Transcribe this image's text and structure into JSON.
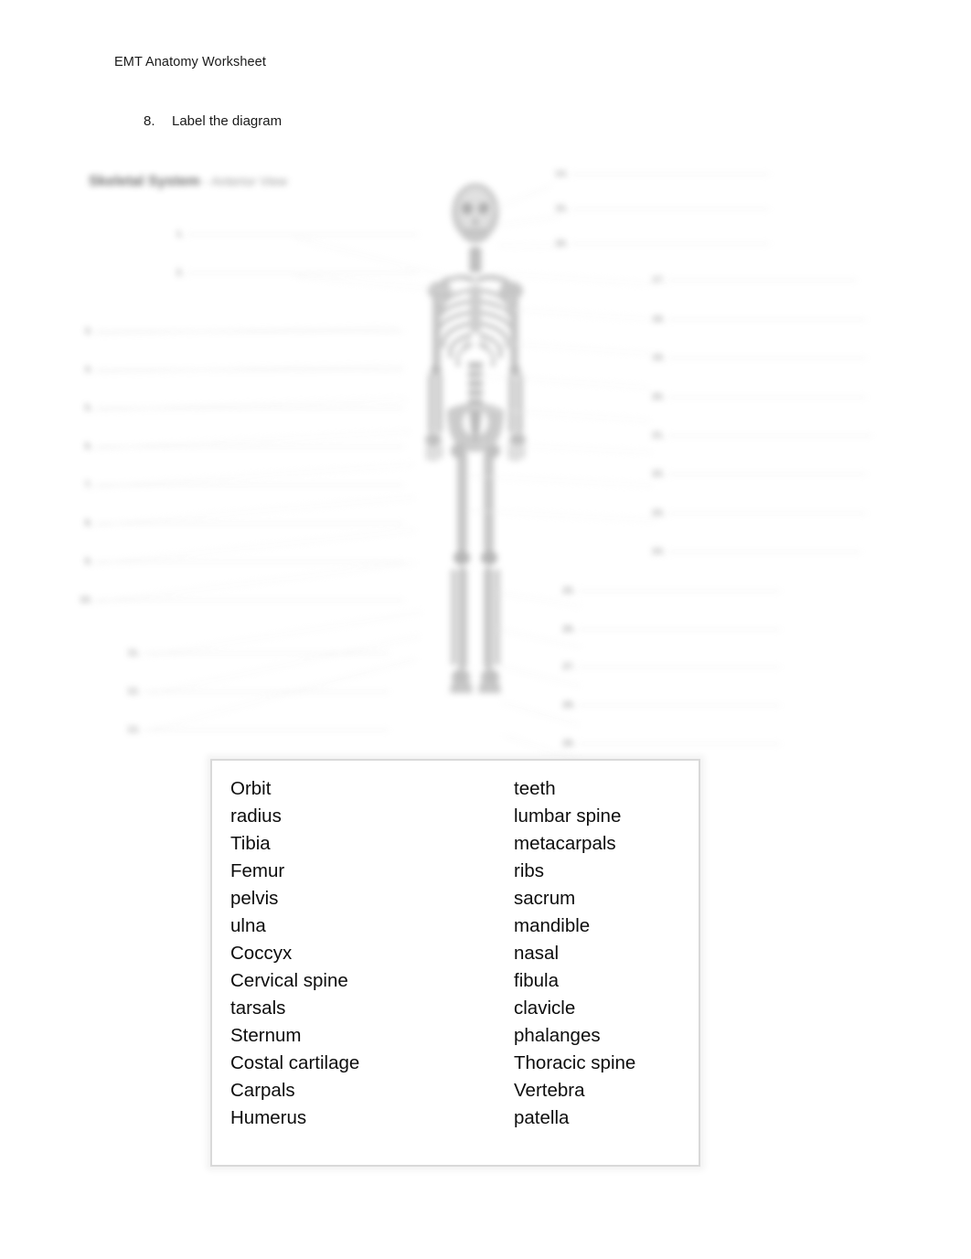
{
  "document": {
    "header": "EMT Anatomy Worksheet"
  },
  "question": {
    "number": "8.",
    "text": "Label the diagram"
  },
  "diagram": {
    "title": "Skeletal System",
    "subtitle": "- Anterior View",
    "figure_name": "human-skeleton-anterior",
    "note": "blurred line-art diagram of the human skeleton with blank numbered label lines",
    "labels_left_upper": [
      "1.",
      "2."
    ],
    "labels_left_middle": [
      "3.",
      "4.",
      "5.",
      "6.",
      "7.",
      "8.",
      "9.",
      "10."
    ],
    "labels_left_lower": [
      "11.",
      "12.",
      "13."
    ],
    "labels_right_upper": [
      "14.",
      "15.",
      "16."
    ],
    "labels_right_middle": [
      "17.",
      "18.",
      "19.",
      "20.",
      "21.",
      "22.",
      "23.",
      "24."
    ],
    "labels_right_lower": [
      "25.",
      "26.",
      "27.",
      "28.",
      "29."
    ]
  },
  "word_bank": {
    "column_left": [
      "Orbit",
      "radius",
      "Tibia",
      "Femur",
      "pelvis",
      "ulna",
      "Coccyx",
      "Cervical spine",
      "tarsals",
      "Sternum",
      "Costal cartilage",
      "Carpals",
      "Humerus"
    ],
    "column_right": [
      "teeth",
      "lumbar spine",
      "metacarpals",
      "ribs",
      "sacrum",
      "mandible",
      "nasal",
      "fibula",
      "clavicle",
      "phalanges",
      "Thoracic spine",
      "Vertebra",
      "patella"
    ]
  },
  "colors": {
    "page_background": "#ffffff",
    "text": "#1a1a1a",
    "word_bank_border": "#d9d9d9",
    "label_rule": "#e2e2e2",
    "bone_fill": "#c9c9c9"
  }
}
